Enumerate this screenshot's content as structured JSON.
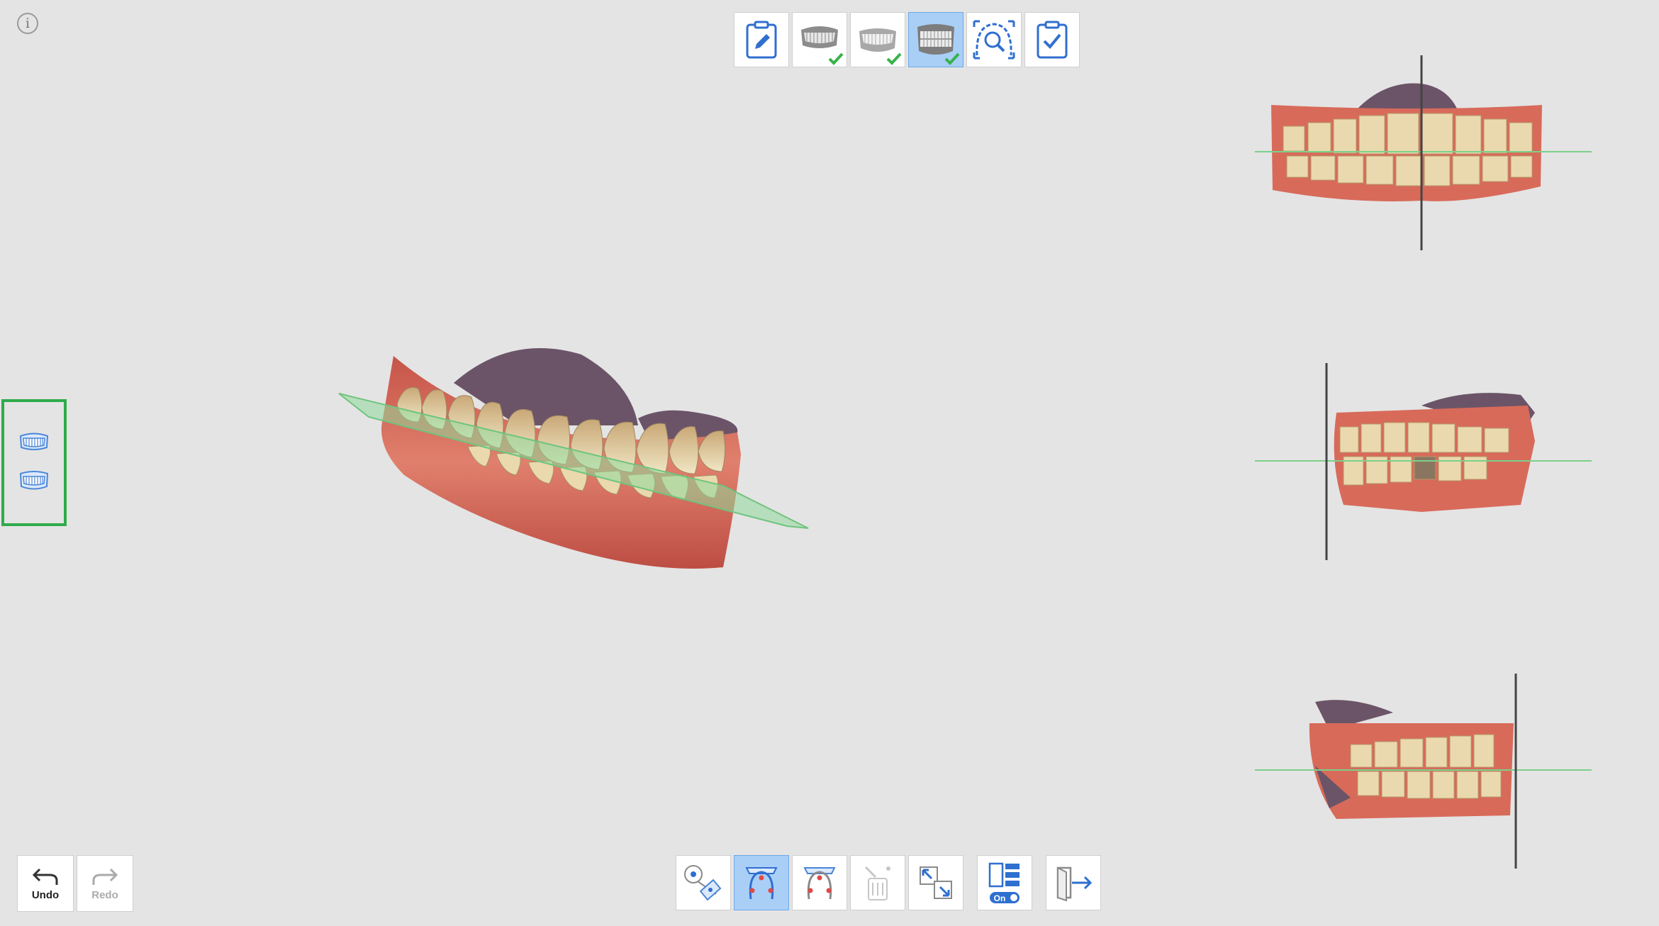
{
  "app": {
    "info_icon": "info-icon",
    "info_glyph": "i"
  },
  "top_toolbar": {
    "items": [
      {
        "name": "order-form-button",
        "icon": "clipboard-pencil-icon",
        "status": "none"
      },
      {
        "name": "upper-jaw-stage-button",
        "icon": "upper-jaw-icon",
        "status": "completed"
      },
      {
        "name": "lower-jaw-stage-button",
        "icon": "lower-jaw-icon",
        "status": "completed"
      },
      {
        "name": "occlusion-stage-button",
        "icon": "occlusion-icon",
        "status": "completed",
        "active": true
      },
      {
        "name": "analysis-stage-button",
        "icon": "arch-magnifier-icon",
        "status": "none"
      },
      {
        "name": "review-complete-button",
        "icon": "clipboard-check-icon",
        "status": "none"
      }
    ]
  },
  "undo_redo": {
    "undo_label": "Undo",
    "redo_label": "Redo",
    "redo_enabled": false
  },
  "bottom_toolbar": {
    "items": [
      {
        "name": "point-alignment-tool",
        "icon": "point-align-icon",
        "active": false
      },
      {
        "name": "upper-occlusal-plane-tool",
        "icon": "upper-arch-plane-icon",
        "active": true
      },
      {
        "name": "lower-occlusal-plane-tool",
        "icon": "lower-arch-plane-icon",
        "active": false
      },
      {
        "name": "trim-tool",
        "icon": "eraser-brush-icon",
        "active": false,
        "disabled": true
      },
      {
        "name": "move-tool",
        "icon": "move-arrows-icon",
        "active": false
      },
      {
        "name": "layout-toggle",
        "icon": "layout-panel-icon",
        "toggle_label": "On"
      },
      {
        "name": "exit-button",
        "icon": "exit-door-icon"
      }
    ]
  },
  "side_panel": {
    "items": [
      {
        "name": "upper-jaw-visibility",
        "icon": "upper-jaw-outline-icon"
      },
      {
        "name": "lower-jaw-visibility",
        "icon": "lower-jaw-outline-icon"
      }
    ]
  },
  "colors": {
    "background": "#e4e4e4",
    "active_button": "#a9cff7",
    "accent_blue": "#2f6fd0",
    "check_green": "#38b24a",
    "side_panel_border": "#2fab4b",
    "plane_green": "#8fd89a",
    "gum": "#d86a5a",
    "tooth": "#e8d8b0",
    "palate": "#6b5468"
  }
}
